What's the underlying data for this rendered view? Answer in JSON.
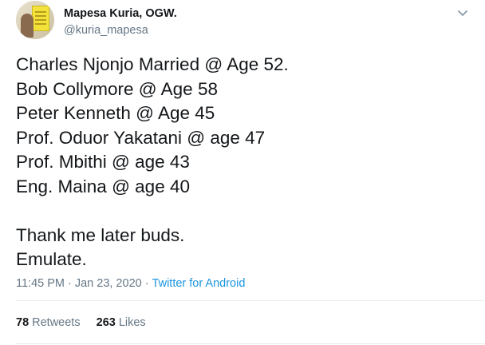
{
  "author": {
    "display_name": "Mapesa Kuria, OGW.",
    "handle": "@kuria_mapesa"
  },
  "tweet": {
    "lines": [
      "Charles Njonjo Married @ Age 52.",
      "Bob Collymore @ Age 58",
      "Peter Kenneth @ Age 45",
      "Prof. Oduor Yakatani @ age 47",
      "Prof. Mbithi @ age 43",
      "Eng. Maina @ age 40"
    ],
    "closing_lines": [
      "Thank me later buds.",
      "Emulate."
    ]
  },
  "meta": {
    "time": "11:45 PM",
    "separator": "·",
    "date": "Jan 23, 2020",
    "source": "Twitter for Android"
  },
  "stats": {
    "retweets_count": "78",
    "retweets_label": "Retweets",
    "likes_count": "263",
    "likes_label": "Likes"
  },
  "icons": {
    "menu": "chevron-down-icon"
  },
  "colors": {
    "text": "#14171a",
    "secondary": "#657786",
    "link": "#1b95e0",
    "divider": "#e6ecf0"
  }
}
